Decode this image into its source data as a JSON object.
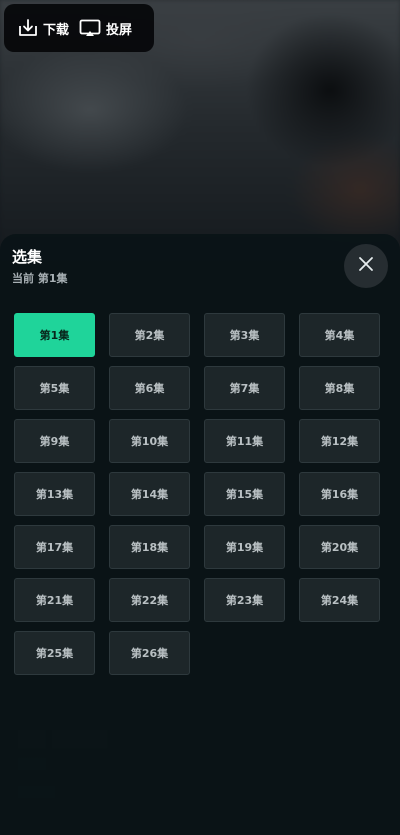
{
  "toolbar": {
    "download_label": "下载",
    "cast_label": "投屏"
  },
  "sheet": {
    "title": "选集",
    "current": "当前 第1集",
    "active_index": 0,
    "episodes": [
      "第1集",
      "第2集",
      "第3集",
      "第4集",
      "第5集",
      "第6集",
      "第7集",
      "第8集",
      "第9集",
      "第10集",
      "第11集",
      "第12集",
      "第13集",
      "第14集",
      "第15集",
      "第16集",
      "第17集",
      "第18集",
      "第19集",
      "第20集",
      "第21集",
      "第22集",
      "第23集",
      "第24集",
      "第25集",
      "第26集"
    ]
  },
  "colors": {
    "accent": "#1fd49a",
    "tile_bg": "#1d2629",
    "sheet_bg": "#0a1417"
  }
}
